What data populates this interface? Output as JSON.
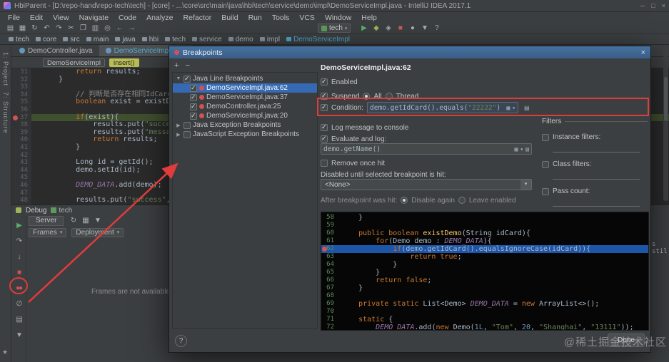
{
  "window": {
    "title": "HbiParent - [D:\\repo-hand\\repo-tech\\tech] - [core] - ...\\core\\src\\main\\java\\hbi\\tech\\service\\demo\\impl\\DemoServiceImpl.java - IntelliJ IDEA 2017.1"
  },
  "icons": {
    "minimize": "─",
    "maximize": "□",
    "close": "×",
    "chevron_down": "▾",
    "grid": "▦",
    "history": "▤",
    "expander_open": "▼",
    "expander_closed": "▶"
  },
  "menu": {
    "items": [
      "File",
      "Edit",
      "View",
      "Navigate",
      "Code",
      "Analyze",
      "Refactor",
      "Build",
      "Run",
      "Tools",
      "VCS",
      "Window",
      "Help"
    ]
  },
  "toolbar": {
    "run_config": "tech",
    "left_icons": [
      {
        "glyph": "▤",
        "name": "open-icon"
      },
      {
        "glyph": "▦",
        "name": "save-all-icon"
      },
      {
        "glyph": "↻",
        "name": "sync-icon"
      },
      {
        "glyph": "↶",
        "name": "undo-icon"
      },
      {
        "glyph": "↷",
        "name": "redo-icon"
      },
      {
        "glyph": "✂",
        "name": "cut-icon"
      },
      {
        "glyph": "❐",
        "name": "copy-icon"
      },
      {
        "glyph": "▥",
        "name": "paste-icon"
      },
      {
        "glyph": "◎",
        "name": "find-icon"
      },
      {
        "glyph": "←",
        "name": "back-icon"
      },
      {
        "glyph": "→",
        "name": "forward-icon"
      }
    ],
    "right_icons": [
      {
        "glyph": "▶",
        "name": "run-icon",
        "cls": "green"
      },
      {
        "glyph": "◆",
        "name": "debug-icon",
        "cls": "olive"
      },
      {
        "glyph": "◈",
        "name": "coverage-icon"
      },
      {
        "glyph": "■",
        "name": "stop-icon",
        "cls": "red"
      },
      {
        "glyph": "●",
        "name": "search-everywhere-icon"
      },
      {
        "glyph": "▼",
        "name": "updates-icon"
      },
      {
        "glyph": "?",
        "name": "help-icon"
      }
    ]
  },
  "breadcrumbs": {
    "items": [
      {
        "label": "tech"
      },
      {
        "label": "core"
      },
      {
        "label": "src"
      },
      {
        "label": "main"
      },
      {
        "label": "java"
      },
      {
        "label": "hbi"
      },
      {
        "label": "tech"
      },
      {
        "label": "service"
      },
      {
        "label": "demo"
      },
      {
        "label": "impl"
      },
      {
        "label": "DemoServiceImpl",
        "current": true
      }
    ]
  },
  "strip": {
    "project": "1: Project",
    "structure": "7: Structure",
    "favorites_glyph": "★"
  },
  "tabs": [
    {
      "label": "DemoController.java"
    },
    {
      "label": "DemoServiceImpl.java"
    }
  ],
  "editor_crumbs": {
    "class_chip": "DemoServiceImpl",
    "method_chip": "insert()"
  },
  "editor": {
    "lines": [
      {
        "n": 31,
        "seg": [
          {
            "t": "        ",
            "c": "pl"
          },
          {
            "t": "return ",
            "c": "kw"
          },
          {
            "t": "results;",
            "c": "pl"
          }
        ]
      },
      {
        "n": 32,
        "seg": [
          {
            "t": "    }",
            "c": "pl"
          }
        ]
      },
      {
        "n": 33,
        "seg": []
      },
      {
        "n": 34,
        "seg": [
          {
            "t": "        ",
            "c": "pl"
          },
          {
            "t": "// 判断是否存在相同IdCard",
            "c": "cmt"
          }
        ]
      },
      {
        "n": 35,
        "seg": [
          {
            "t": "        ",
            "c": "pl"
          },
          {
            "t": "boolean ",
            "c": "kw"
          },
          {
            "t": "exist = existDemo(dem",
            "c": "pl"
          }
        ]
      },
      {
        "n": 36,
        "seg": []
      },
      {
        "n": 37,
        "hl": "exec",
        "bp": true,
        "seg": [
          {
            "t": "        ",
            "c": "pl"
          },
          {
            "t": "if",
            "c": "kw"
          },
          {
            "t": "(exist){",
            "c": "pl"
          }
        ]
      },
      {
        "n": 38,
        "seg": [
          {
            "t": "            results.put(",
            "c": "pl"
          },
          {
            "t": "\"success\"",
            "c": "str"
          },
          {
            "t": ", ",
            "c": "pl"
          },
          {
            "t": "fa",
            "c": "kw"
          }
        ]
      },
      {
        "n": 39,
        "seg": [
          {
            "t": "            results.put(",
            "c": "pl"
          },
          {
            "t": "\"message\"",
            "c": "str"
          },
          {
            "t": ", ",
            "c": "pl"
          },
          {
            "t": "\"I",
            "c": "str"
          }
        ]
      },
      {
        "n": 40,
        "seg": [
          {
            "t": "            ",
            "c": "pl"
          },
          {
            "t": "return ",
            "c": "kw"
          },
          {
            "t": "results;",
            "c": "pl"
          }
        ]
      },
      {
        "n": 41,
        "seg": [
          {
            "t": "        }",
            "c": "pl"
          }
        ]
      },
      {
        "n": 42,
        "seg": []
      },
      {
        "n": 43,
        "seg": [
          {
            "t": "        Long id = getId();",
            "c": "pl"
          }
        ]
      },
      {
        "n": 44,
        "seg": [
          {
            "t": "        demo.setId(id);",
            "c": "pl"
          }
        ]
      },
      {
        "n": 45,
        "seg": []
      },
      {
        "n": 46,
        "seg": [
          {
            "t": "        ",
            "c": "pl"
          },
          {
            "t": "DEMO_DATA",
            "c": "fld"
          },
          {
            "t": ".add(demo);",
            "c": "pl"
          }
        ]
      },
      {
        "n": 47,
        "seg": []
      },
      {
        "n": 48,
        "seg": [
          {
            "t": "        results.put(",
            "c": "pl"
          },
          {
            "t": "\"success\"",
            "c": "str"
          },
          {
            "t": ", ",
            "c": "pl"
          },
          {
            "t": "true",
            "c": "kw"
          },
          {
            "t": ")",
            "c": "pl"
          }
        ]
      }
    ]
  },
  "debug": {
    "tab": "Debug",
    "session": "tech",
    "server_tab": "Server",
    "frames": "Frames",
    "deployment": "Deployment",
    "empty_text": "Frames are not available",
    "row2_icons": [
      {
        "glyph": "↻",
        "name": "rerun-icon"
      },
      {
        "glyph": "▦",
        "name": "settings-icon"
      },
      {
        "glyph": "▼",
        "name": "more-icon"
      }
    ],
    "side_icons": [
      {
        "glyph": "▶",
        "name": "resume-icon",
        "cls": "green"
      },
      {
        "glyph": "↷",
        "name": "step-over-icon"
      },
      {
        "glyph": "↓",
        "name": "step-into-icon"
      },
      {
        "glyph": "■",
        "name": "stop-icon",
        "cls": "red"
      },
      {
        "glyph": "●●",
        "name": "view-breakpoints-icon",
        "cls": "red"
      },
      {
        "glyph": "∅",
        "name": "mute-breakpoints-icon"
      },
      {
        "glyph": "▤",
        "name": "restore-layout-icon"
      },
      {
        "glyph": "▼",
        "name": "collapse-icon"
      }
    ]
  },
  "dialog": {
    "title": "Breakpoints",
    "toolbar_icons": [
      {
        "glyph": "+",
        "name": "add-breakpoint-icon"
      },
      {
        "glyph": "−",
        "name": "remove-breakpoint-icon"
      }
    ],
    "tree": {
      "items": [
        {
          "label": "Java Line Breakpoints"
        },
        {
          "label": "DemoServiceImpl.java:62"
        },
        {
          "label": "DemoServiceImpl.java:37"
        },
        {
          "label": "DemoController.java:25"
        },
        {
          "label": "DemoServiceImpl.java:20"
        },
        {
          "label": "Java Exception Breakpoints"
        },
        {
          "label": "JavaScript Exception Breakpoints"
        }
      ]
    },
    "details": {
      "header": "DemoServiceImpl.java:62",
      "enabled_label": "Enabled",
      "suspend_label": "Suspend",
      "suspend_all": "All",
      "suspend_thread": "Thread",
      "condition_label": "Condition:",
      "condition_seg": [
        {
          "t": "demo.getIdCard().equals(",
          "c": "pl"
        },
        {
          "t": "\"22222\"",
          "c": "str"
        },
        {
          "t": ")",
          "c": "pl"
        }
      ],
      "log_label": "Log message to console",
      "evaluate_label": "Evaluate and log:",
      "evaluate_seg": [
        {
          "t": "demo.getName()",
          "c": "pl"
        }
      ],
      "remove_label": "Remove once hit",
      "disabled_until_label": "Disabled until selected breakpoint is hit:",
      "disabled_until_value": "<None>",
      "after_hit_label": "After breakpoint was hit:",
      "disable_again": "Disable again",
      "leave_enabled": "Leave enabled"
    },
    "filters": {
      "title": "Filters",
      "instance": "Instance filters:",
      "class": "Class filters:",
      "pass": "Pass count:"
    },
    "preview": {
      "lines": [
        {
          "n": 58,
          "seg": [
            {
              "t": "    }",
              "c": "pl"
            }
          ]
        },
        {
          "n": 59,
          "seg": []
        },
        {
          "n": 60,
          "seg": [
            {
              "t": "    ",
              "c": "pl"
            },
            {
              "t": "public boolean ",
              "c": "kw"
            },
            {
              "t": "existDemo",
              "c": "mth"
            },
            {
              "t": "(String idCard){",
              "c": "pl"
            }
          ]
        },
        {
          "n": 61,
          "seg": [
            {
              "t": "        ",
              "c": "pl"
            },
            {
              "t": "for",
              "c": "kw"
            },
            {
              "t": "(Demo demo : ",
              "c": "pl"
            },
            {
              "t": "DEMO_DATA",
              "c": "fld"
            },
            {
              "t": "){",
              "c": "pl"
            }
          ]
        },
        {
          "n": 62,
          "hl": "sel",
          "bp": true,
          "seg": [
            {
              "t": "            ",
              "c": "pl"
            },
            {
              "t": "if",
              "c": "kw"
            },
            {
              "t": "(demo.getIdCard().equalsIgnoreCase(idCard)){",
              "c": "pl"
            }
          ]
        },
        {
          "n": 63,
          "seg": [
            {
              "t": "                ",
              "c": "pl"
            },
            {
              "t": "return true",
              "c": "kw"
            },
            {
              "t": ";",
              "c": "pl"
            }
          ]
        },
        {
          "n": 64,
          "seg": [
            {
              "t": "            }",
              "c": "pl"
            }
          ]
        },
        {
          "n": 65,
          "seg": [
            {
              "t": "        }",
              "c": "pl"
            }
          ]
        },
        {
          "n": 66,
          "seg": [
            {
              "t": "        ",
              "c": "pl"
            },
            {
              "t": "return false",
              "c": "kw"
            },
            {
              "t": ";",
              "c": "pl"
            }
          ]
        },
        {
          "n": 67,
          "seg": [
            {
              "t": "    }",
              "c": "pl"
            }
          ]
        },
        {
          "n": 68,
          "seg": []
        },
        {
          "n": 69,
          "seg": [
            {
              "t": "    ",
              "c": "pl"
            },
            {
              "t": "private static ",
              "c": "kw"
            },
            {
              "t": "List<Demo> ",
              "c": "pl"
            },
            {
              "t": "DEMO_DATA",
              "c": "fld"
            },
            {
              "t": " = ",
              "c": "pl"
            },
            {
              "t": "new ",
              "c": "kw"
            },
            {
              "t": "ArrayList<>();",
              "c": "pl"
            }
          ]
        },
        {
          "n": 70,
          "seg": []
        },
        {
          "n": 71,
          "seg": [
            {
              "t": "    ",
              "c": "pl"
            },
            {
              "t": "static ",
              "c": "kw"
            },
            {
              "t": "{",
              "c": "pl"
            }
          ]
        },
        {
          "n": 72,
          "seg": [
            {
              "t": "        ",
              "c": "pl"
            },
            {
              "t": "DEMO_DATA",
              "c": "fld"
            },
            {
              "t": ".add(",
              "c": "pl"
            },
            {
              "t": "new ",
              "c": "kw"
            },
            {
              "t": "Demo(",
              "c": "pl"
            },
            {
              "t": "1L",
              "c": "num"
            },
            {
              "t": ", ",
              "c": "pl"
            },
            {
              "t": "\"Tom\"",
              "c": "str"
            },
            {
              "t": ", ",
              "c": "pl"
            },
            {
              "t": "20",
              "c": "num"
            },
            {
              "t": ", ",
              "c": "pl"
            },
            {
              "t": "\"Shanghai\"",
              "c": "str"
            },
            {
              "t": ", ",
              "c": "pl"
            },
            {
              "t": "\"13111\"",
              "c": "str"
            },
            {
              "t": "));",
              "c": "pl"
            }
          ]
        }
      ]
    },
    "help_label": "?",
    "done_label": "Done"
  },
  "misc": {
    "watermark": "@稀土掘金技术社区",
    "right_edge_text": "s stil"
  }
}
